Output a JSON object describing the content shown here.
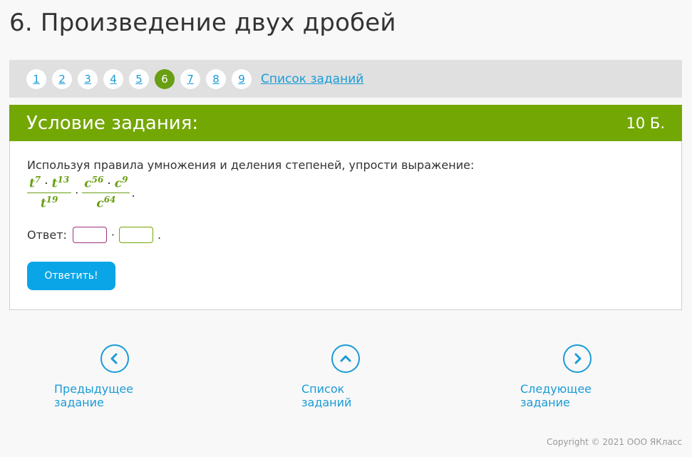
{
  "page": {
    "title": "6. Произведение двух дробей"
  },
  "pager": {
    "pages": [
      "1",
      "2",
      "3",
      "4",
      "5",
      "6",
      "7",
      "8",
      "9"
    ],
    "active_index": 5,
    "list_link": "Список заданий"
  },
  "task": {
    "header_title": "Условие задания:",
    "points": "10 Б.",
    "instruction": "Используя правила умножения и деления степеней, упрости выражение:",
    "expression": {
      "fraction1": {
        "num_base1": "t",
        "num_exp1": "7",
        "num_base2": "t",
        "num_exp2": "13",
        "den_base": "t",
        "den_exp": "19"
      },
      "fraction2": {
        "num_base1": "c",
        "num_exp1": "56",
        "num_base2": "c",
        "num_exp2": "9",
        "den_base": "c",
        "den_exp": "64"
      },
      "operator": "·",
      "end": "."
    },
    "answer_label": "Ответ:",
    "answer_operator": "·",
    "answer_end": ".",
    "answer_values": [
      "",
      ""
    ],
    "submit_label": "Ответить!"
  },
  "nav": {
    "prev_label": "Предыдущее задание",
    "list_label": "Список заданий",
    "next_label": "Следующее задание"
  },
  "footer": {
    "copyright": "Copyright © 2021 ООО ЯКласс"
  },
  "colors": {
    "accent_green": "#73a703",
    "link_blue": "#1a9bd7",
    "button_blue": "#0aa5e6",
    "input_magenta": "#a0307a"
  }
}
